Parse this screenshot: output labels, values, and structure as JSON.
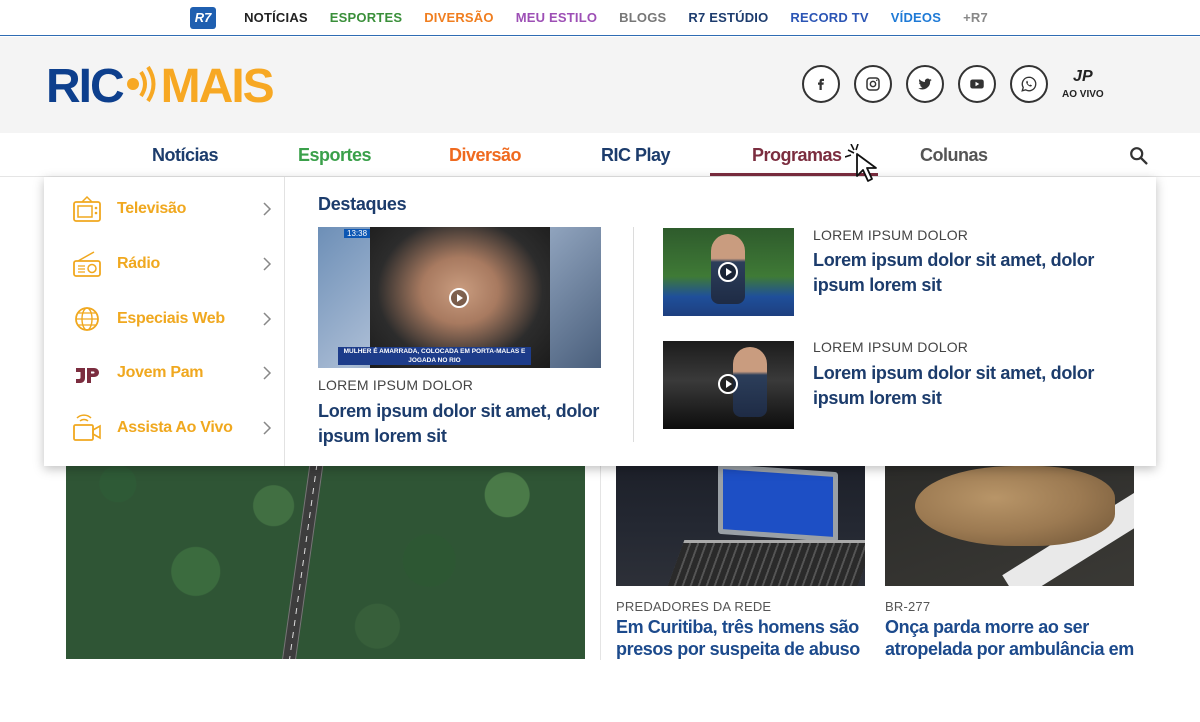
{
  "r7bar": {
    "logo": "R7",
    "links": [
      {
        "label": "NOTÍCIAS",
        "color": "#222222"
      },
      {
        "label": "ESPORTES",
        "color": "#3a8f3a"
      },
      {
        "label": "DIVERSÃO",
        "color": "#f07e1f"
      },
      {
        "label": "MEU ESTILO",
        "color": "#9d4fb5"
      },
      {
        "label": "BLOGS",
        "color": "#777777"
      },
      {
        "label": "R7 ESTÚDIO",
        "color": "#1d3c6e"
      },
      {
        "label": "RECORD TV",
        "color": "#2b55b5"
      },
      {
        "label": "VÍDEOS",
        "color": "#1e7ad6"
      },
      {
        "label": "+R7",
        "color": "#888888"
      }
    ]
  },
  "header": {
    "logo_left": "RIC",
    "logo_right": "MAIS",
    "socials": [
      "facebook-icon",
      "instagram-icon",
      "twitter-icon",
      "youtube-icon",
      "whatsapp-icon"
    ],
    "live": {
      "brand": "JP",
      "label": "AO VIVO"
    }
  },
  "nav": {
    "items": [
      {
        "label": "Notícias",
        "color": "#1c3c6c"
      },
      {
        "label": "Esportes",
        "color": "#3aa04a"
      },
      {
        "label": "Diversão",
        "color": "#ef6a1f"
      },
      {
        "label": "RIC Play",
        "color": "#1c3c6c"
      },
      {
        "label": "Programas",
        "color": "#7b2d3f"
      },
      {
        "label": "Colunas",
        "color": "#555555"
      }
    ],
    "active": "Programas"
  },
  "dropdown": {
    "menu": [
      {
        "label": "Televisão",
        "icon": "tv-icon"
      },
      {
        "label": "Rádio",
        "icon": "radio-icon"
      },
      {
        "label": "Especiais Web",
        "icon": "globe-icon"
      },
      {
        "label": "Jovem Pam",
        "icon": "jp-logo-icon"
      },
      {
        "label": "Assista Ao Vivo",
        "icon": "live-tv-icon"
      }
    ],
    "highlights_title": "Destaques",
    "featured": {
      "timestamp": "13:38",
      "caption": "MULHER É AMARRADA, COLOCADA EM PORTA-MALAS E JOGADA NO RIO",
      "kicker": "LOREM IPSUM DOLOR",
      "title": "Lorem ipsum dolor sit amet, dolor ipsum lorem sit"
    },
    "side": [
      {
        "kicker": "LOREM IPSUM DOLOR",
        "title": "Lorem ipsum dolor sit amet, dolor ipsum lorem sit"
      },
      {
        "kicker": "LOREM IPSUM DOLOR",
        "title": "Lorem ipsum dolor sit amet, dolor ipsum lorem sit"
      }
    ]
  },
  "cards": [
    {
      "kicker": "PREDADORES DA REDE",
      "title": "Em Curitiba, três homens são presos por suspeita de abuso"
    },
    {
      "kicker": "BR-277",
      "title": "Onça parda morre ao ser atropelada por ambulância em"
    }
  ],
  "colors": {
    "accent_orange": "#f0a81f",
    "navy": "#1c3c6c",
    "programas": "#7b2d3f"
  }
}
